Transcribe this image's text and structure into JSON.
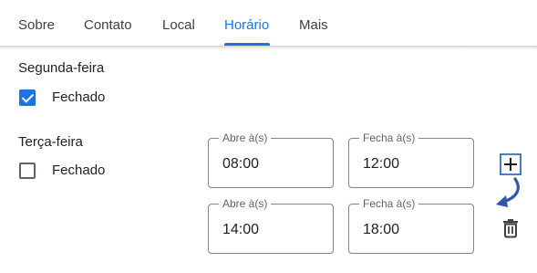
{
  "tabs": [
    {
      "label": "Sobre",
      "active": false
    },
    {
      "label": "Contato",
      "active": false
    },
    {
      "label": "Local",
      "active": false
    },
    {
      "label": "Horário",
      "active": true
    },
    {
      "label": "Mais",
      "active": false
    }
  ],
  "colors": {
    "accent": "#1a73e8",
    "text": "#202124",
    "outline": "#80868b"
  },
  "days": [
    {
      "name": "Segunda-feira",
      "closed": true,
      "closed_label": "Fechado"
    },
    {
      "name": "Terça-feira",
      "closed": false,
      "closed_label": "Fechado",
      "ranges": [
        {
          "open_label": "Abre à(s)",
          "open": "08:00",
          "close_label": "Fecha à(s)",
          "close": "12:00"
        },
        {
          "open_label": "Abre à(s)",
          "open": "14:00",
          "close_label": "Fecha à(s)",
          "close": "18:00"
        }
      ]
    }
  ],
  "icons": {
    "add": "plus-icon",
    "delete": "trash-icon",
    "arrow": "curved-arrow-icon"
  }
}
